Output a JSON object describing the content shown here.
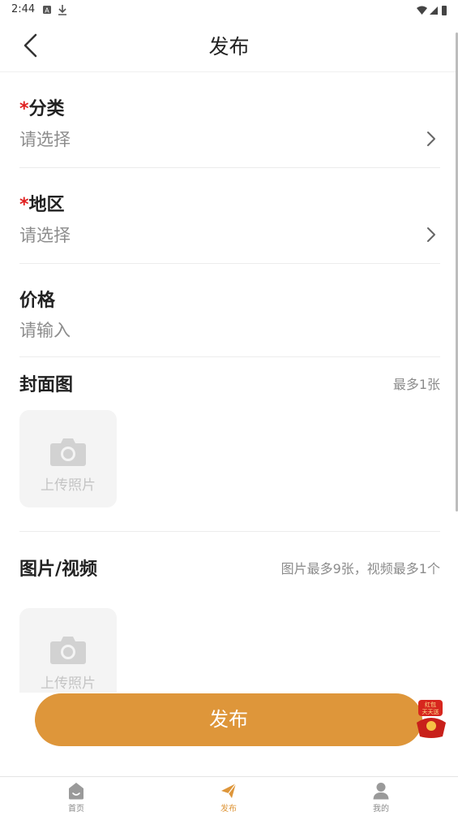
{
  "status_bar": {
    "time": "2:44"
  },
  "header": {
    "title": "发布"
  },
  "form": {
    "required_mark": "*",
    "category": {
      "label": "分类",
      "placeholder": "请选择"
    },
    "region": {
      "label": "地区",
      "placeholder": "请选择"
    },
    "price": {
      "label": "价格",
      "placeholder": "请输入"
    }
  },
  "cover": {
    "title": "封面图",
    "hint": "最多1张",
    "upload_label": "上传照片"
  },
  "media": {
    "title": "图片/视频",
    "hint": "图片最多9张，视频最多1个",
    "upload_label": "上传照片"
  },
  "publish_button": {
    "label": "发布"
  },
  "red_packet": {
    "text": "红包天天送"
  },
  "tab_bar": {
    "items": [
      {
        "label": "首页",
        "icon": "home-icon",
        "active": false
      },
      {
        "label": "发布",
        "icon": "paper-plane-icon",
        "active": true
      },
      {
        "label": "我的",
        "icon": "user-icon",
        "active": false
      }
    ]
  },
  "colors": {
    "accent": "#de963a",
    "required": "#e02020",
    "placeholder": "#8c8c8c"
  }
}
